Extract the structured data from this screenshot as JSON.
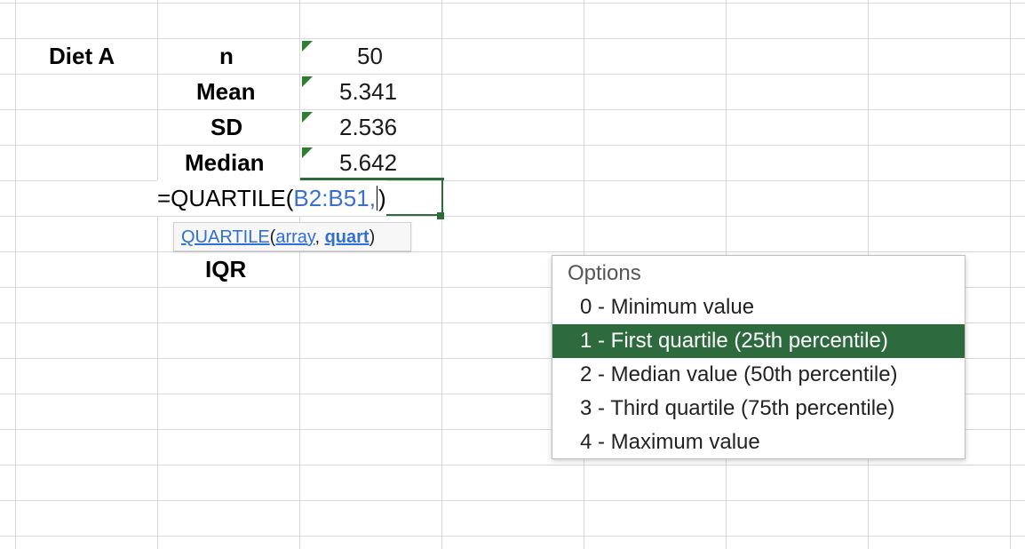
{
  "sheet": {
    "group_label": "Diet A",
    "stats": [
      {
        "label": "n",
        "value": "50"
      },
      {
        "label": "Mean",
        "value": "5.341"
      },
      {
        "label": "SD",
        "value": "2.536"
      },
      {
        "label": "Median",
        "value": "5.642"
      }
    ],
    "iqr_label": "IQR"
  },
  "editor": {
    "formula_prefix": "=QUARTILE(",
    "range_ref": "B2:B51",
    "separator": ",",
    "formula_suffix": ")"
  },
  "tooltip": {
    "func_name": "QUARTILE",
    "open_paren": "(",
    "arg1": "array",
    "comma": ", ",
    "arg2": "quart",
    "close_paren": ")"
  },
  "options": {
    "header": "Options",
    "items": [
      "0 - Minimum value",
      "1 - First quartile (25th percentile)",
      "2 - Median value (50th percentile)",
      "3 - Third quartile (75th percentile)",
      "4 - Maximum value"
    ],
    "selected_index": 1
  },
  "colors": {
    "accent_green": "#2d6a3e",
    "reference_blue": "#3a6fd1",
    "grid_line": "#d9d9d9"
  }
}
